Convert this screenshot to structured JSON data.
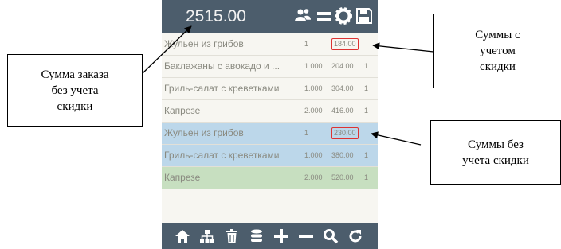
{
  "screen": {
    "order_total": "2515.00",
    "toolbar_icons": [
      "users-icon",
      "menu-icon",
      "gear-icon",
      "save-icon"
    ],
    "items": [
      {
        "name": "Жульен из грибов",
        "qty": "1",
        "sum": "184.00",
        "n": "",
        "style": "plain",
        "sum_boxed": true
      },
      {
        "name": "Баклажаны с авокадо и ...",
        "qty": "1.000",
        "sum": "204.00",
        "n": "1",
        "style": "plain",
        "sum_boxed": false
      },
      {
        "name": "Гриль-салат с креветками",
        "qty": "1.000",
        "sum": "304.00",
        "n": "1",
        "style": "plain",
        "sum_boxed": false
      },
      {
        "name": "Капрезе",
        "qty": "2.000",
        "sum": "416.00",
        "n": "1",
        "style": "plain",
        "sum_boxed": false
      },
      {
        "name": "Жульен из грибов",
        "qty": "1",
        "sum": "230.00",
        "n": "",
        "style": "blue",
        "sum_boxed": true
      },
      {
        "name": "Гриль-салат с креветками",
        "qty": "1.000",
        "sum": "380.00",
        "n": "1",
        "style": "blue",
        "sum_boxed": false
      },
      {
        "name": "Капрезе",
        "qty": "2.000",
        "sum": "520.00",
        "n": "1",
        "style": "green",
        "sum_boxed": false
      }
    ],
    "bottom_icons": [
      "home-icon",
      "sitemap-icon",
      "trash-icon",
      "list-icon",
      "plus-icon",
      "minus-icon",
      "search-icon",
      "refresh-icon"
    ],
    "colors": {
      "bar": "#4c5d6c",
      "blue_row": "#bcd7ea",
      "green_row": "#c7dfc0",
      "box_border": "#dd3333"
    }
  },
  "callouts": {
    "left": [
      "Сумма заказа",
      "без учета",
      "скидки"
    ],
    "top_right": [
      "Суммы с",
      "учетом",
      "скидки"
    ],
    "bottom_right": [
      "Суммы без",
      "учета скидки"
    ]
  }
}
